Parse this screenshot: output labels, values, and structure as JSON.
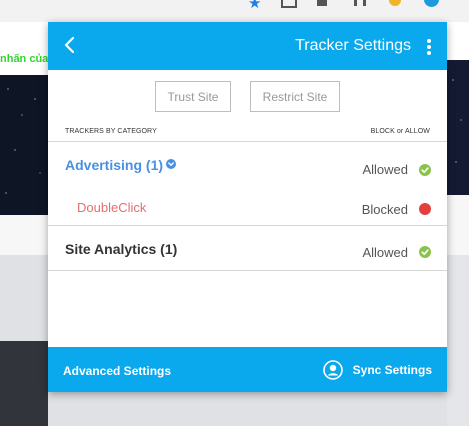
{
  "background": {
    "green_text": "nhấn của l"
  },
  "header": {
    "title": "Tracker Settings",
    "back_icon": "chevron-left-icon",
    "menu_icon": "kebab-menu-icon"
  },
  "actions": {
    "trust_label": "Trust Site",
    "restrict_label": "Restrict Site"
  },
  "columns": {
    "left": "TRACKERS BY CATEGORY",
    "right": "BLOCK or ALLOW"
  },
  "categories": [
    {
      "name": "Advertising (1)",
      "status": "Allowed",
      "expanded": true,
      "trackers": [
        {
          "name": "DoubleClick",
          "status": "Blocked"
        }
      ]
    },
    {
      "name": "Site Analytics (1)",
      "status": "Allowed",
      "expanded": false,
      "trackers": []
    }
  ],
  "footer": {
    "advanced_label": "Advanced Settings",
    "sync_label": "Sync Settings"
  },
  "colors": {
    "header_blue": "#0aa8ec",
    "link_blue": "#4a90e2",
    "tracker_red": "#e36f6f",
    "allowed_green": "#8bc34a",
    "blocked_red": "#e2403f"
  }
}
